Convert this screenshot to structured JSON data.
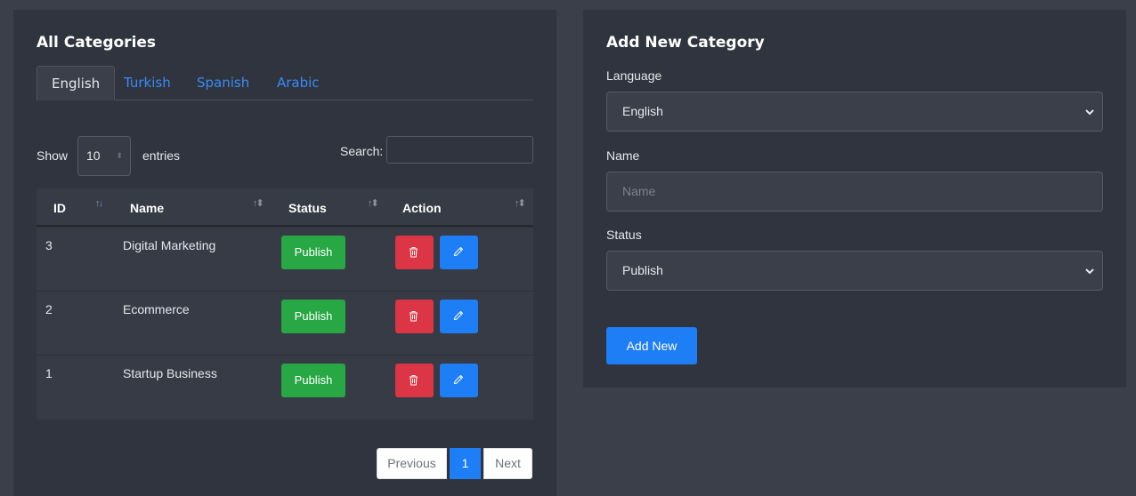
{
  "left": {
    "title": "All Categories",
    "tabs": [
      "English",
      "Turkish",
      "Spanish",
      "Arabic"
    ],
    "active_tab": "English",
    "show_label": "Show",
    "entries_value": "10",
    "entries_label": "entries",
    "search_label": "Search:",
    "columns": [
      "ID",
      "Name",
      "Status",
      "Action"
    ],
    "rows": [
      {
        "id": "3",
        "name": "Digital Marketing",
        "status": "Publish"
      },
      {
        "id": "2",
        "name": "Ecommerce",
        "status": "Publish"
      },
      {
        "id": "1",
        "name": "Startup Business",
        "status": "Publish"
      }
    ],
    "pagination": {
      "previous": "Previous",
      "page": "1",
      "next": "Next"
    }
  },
  "right": {
    "title": "Add New Category",
    "language_label": "Language",
    "language_value": "English",
    "name_label": "Name",
    "name_placeholder": "Name",
    "status_label": "Status",
    "status_value": "Publish",
    "add_button": "Add New"
  },
  "icons": {
    "delete": "trash-icon",
    "edit": "pencil-icon",
    "sort": "sort-icon",
    "select": "chevron-down-icon"
  },
  "colors": {
    "publish": "#28a745",
    "delete": "#dc3545",
    "primary": "#1e7ef5",
    "tab_link": "#3a8bf7"
  }
}
